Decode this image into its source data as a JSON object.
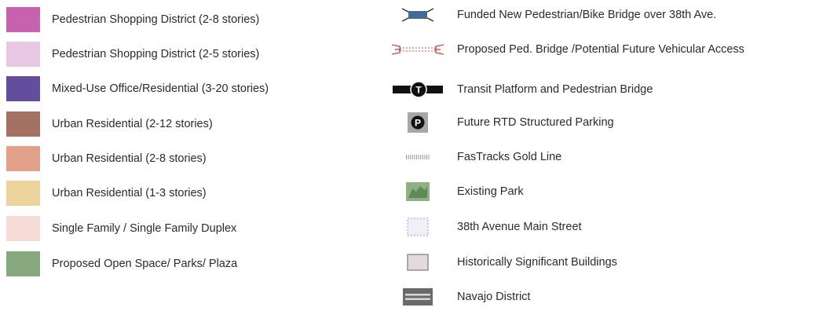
{
  "left_items": [
    {
      "label": "Pedestrian Shopping District (2-8 stories)",
      "color": "#c862ae"
    },
    {
      "label": "Pedestrian Shopping District (2-5 stories)",
      "color": "#e6c8e2"
    },
    {
      "label": "Mixed-Use Office/Residential (3-20 stories)",
      "color": "#634e9e"
    },
    {
      "label": "Urban Residential (2-12 stories)",
      "color": "#a57164"
    },
    {
      "label": "Urban Residential (2-8 stories)",
      "color": "#e2a088"
    },
    {
      "label": "Urban Residential (1-3 stories)",
      "color": "#ecd39b"
    },
    {
      "label": "Single Family / Single Family Duplex",
      "color": "#f6dcd6"
    },
    {
      "label": "Proposed Open Space/ Parks/ Plaza",
      "color": "#86a97f"
    }
  ],
  "right_items": [
    {
      "label": "Funded New Pedestrian/Bike Bridge over 38th Ave.",
      "icon": "bridge-icon"
    },
    {
      "label": "Proposed Ped. Bridge /Potential Future Vehicular Access",
      "icon": "proposed-bridge-icon"
    },
    {
      "label": "Transit Platform and Pedestrian Bridge",
      "icon": "transit-platform-icon",
      "glyph": "T"
    },
    {
      "label": "Future RTD Structured Parking",
      "icon": "parking-icon",
      "glyph": "P"
    },
    {
      "label": "FasTracks Gold Line",
      "icon": "rail-line-icon"
    },
    {
      "label": "Existing Park",
      "icon": "park-icon"
    },
    {
      "label": "38th Avenue Main Street",
      "icon": "main-street-icon"
    },
    {
      "label": "Historically Significant Buildings",
      "icon": "historic-building-icon"
    },
    {
      "label": "Navajo District",
      "icon": "navajo-district-icon"
    }
  ],
  "colors": {
    "bridge_blue": "#3f6a9c",
    "park_green": "#7aa072",
    "main_street_fill": "#eef0f8",
    "historic_fill": "#e4dadb",
    "navajo_gray": "#6a6a6a"
  }
}
